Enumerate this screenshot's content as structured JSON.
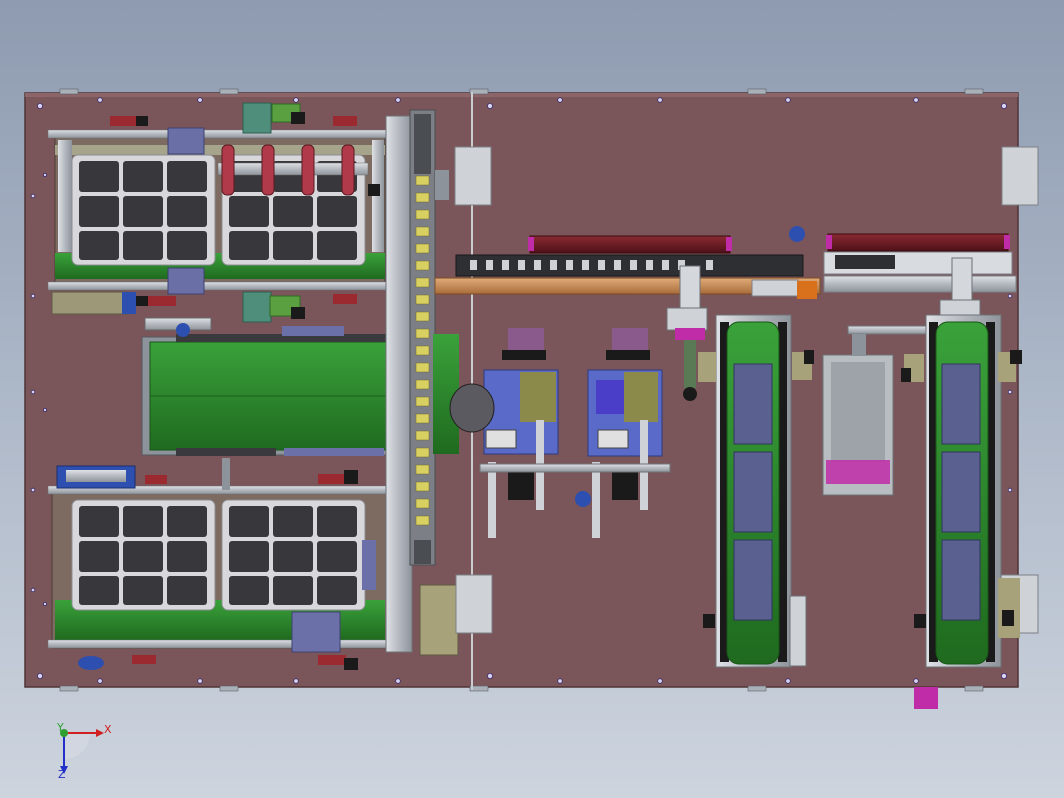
{
  "view": {
    "background_top": "#8e9bb0",
    "background_bottom": "#cdd4de"
  },
  "colors": {
    "plate": "#7a5559",
    "plate_edge": "#5e3f43",
    "aluminum": "#b9bec4",
    "aluminum_dark": "#8d939a",
    "tray_cell": "#3a3a3e",
    "tray_frame": "#d4d4d8",
    "green_belt": "#2e8b2e",
    "green_dark": "#1f6a1f",
    "blue": "#2d4fb0",
    "magenta": "#c02ca8",
    "dark_red": "#6a1a22",
    "copper": "#c48a52",
    "orange": "#d8701c"
  },
  "triad": {
    "x_label": "X",
    "y_label": "Y",
    "z_label": "Z"
  }
}
